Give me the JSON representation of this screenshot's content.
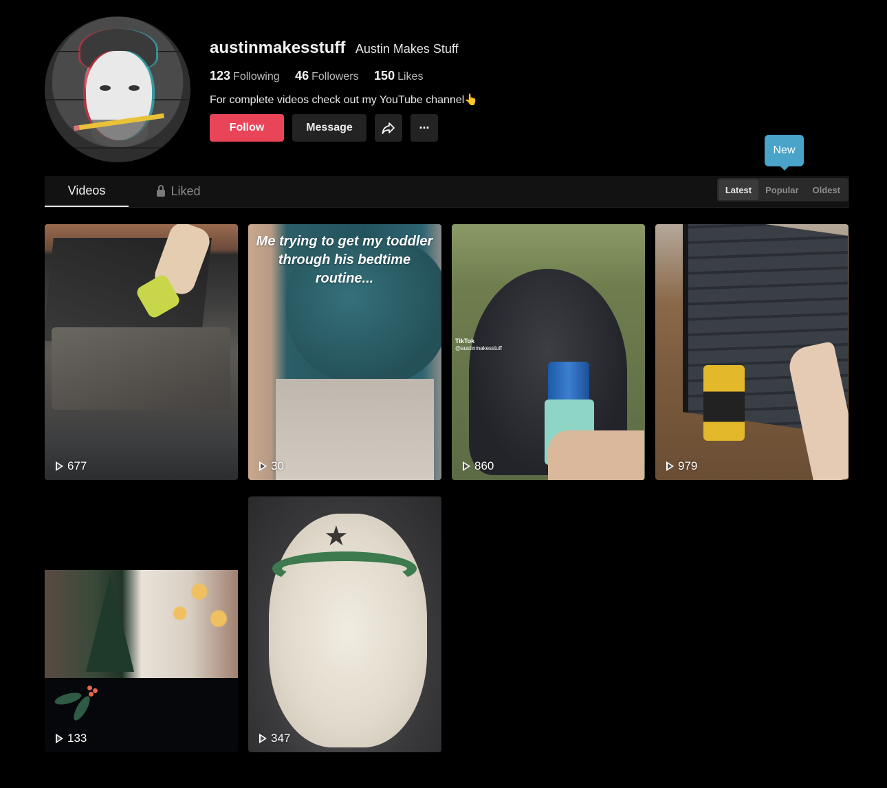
{
  "profile": {
    "username": "austinmakesstuff",
    "nickname": "Austin Makes Stuff",
    "stats": [
      {
        "value": "123",
        "label": "Following"
      },
      {
        "value": "46",
        "label": "Followers"
      },
      {
        "value": "150",
        "label": "Likes"
      }
    ],
    "bio": "For complete videos check out my YouTube channel👆",
    "actions": {
      "follow": "Follow",
      "message": "Message",
      "share_icon": "share-arrow-icon",
      "more_icon": "more-ellipsis-icon",
      "more_glyph": "···"
    },
    "accent_color": "#ea4458"
  },
  "tabs": [
    {
      "label": "Videos",
      "active": true
    },
    {
      "label": "Liked",
      "active": false,
      "icon": "lock-icon"
    }
  ],
  "sort": {
    "tooltip": "New",
    "options": [
      {
        "label": "Latest",
        "active": true
      },
      {
        "label": "Popular",
        "active": false
      },
      {
        "label": "Oldest",
        "active": false
      }
    ]
  },
  "videos": [
    {
      "views": "677"
    },
    {
      "views": "30",
      "caption": "Me trying to get my toddler through his bedtime routine..."
    },
    {
      "views": "860",
      "watermark": "TikTok",
      "watermark_handle": "@austinmakesstuff"
    },
    {
      "views": "979"
    },
    {
      "views": "133"
    },
    {
      "views": "347"
    }
  ]
}
